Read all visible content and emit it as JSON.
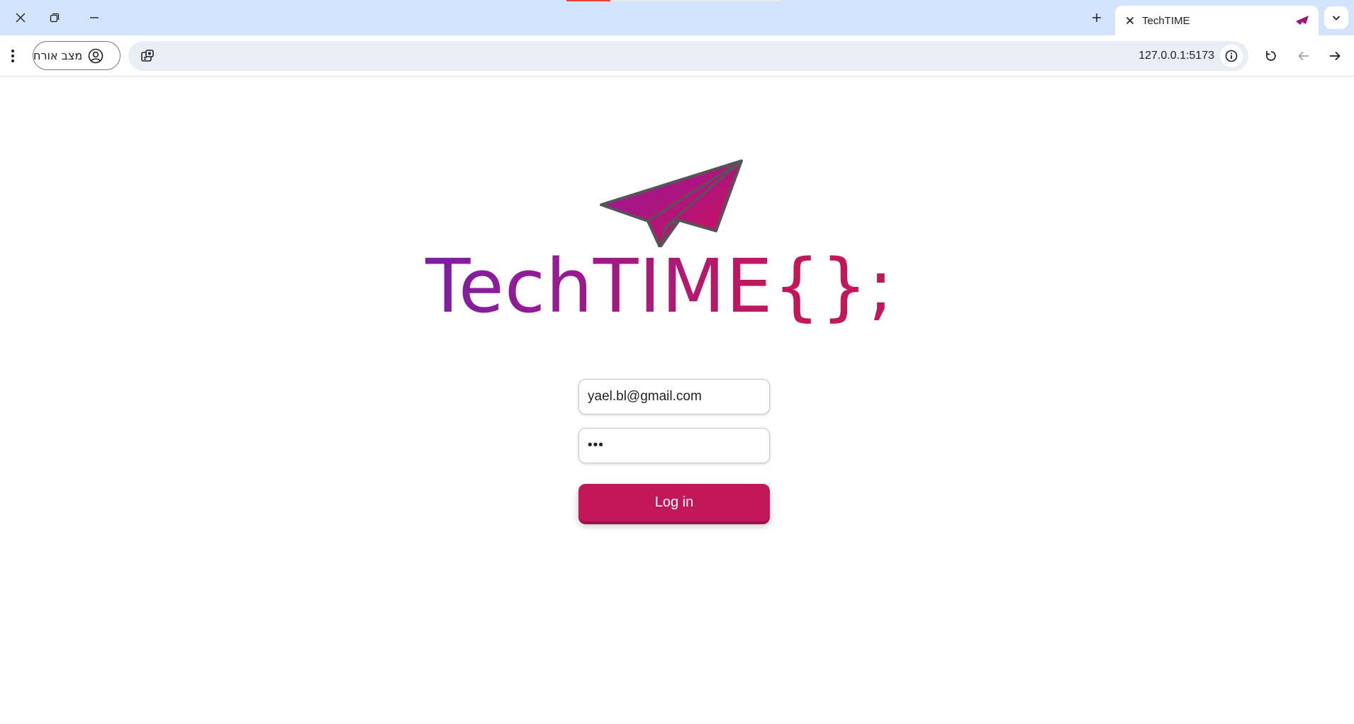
{
  "browser": {
    "tab": {
      "title": "TechTIME"
    },
    "profile_chip": {
      "label": "מצב אורח"
    },
    "omnibox": {
      "url": "127.0.0.1:5173"
    }
  },
  "page": {
    "logo": {
      "word": "TechTIME",
      "braces": "{};"
    },
    "login_form": {
      "email_value": "yael.bl@gmail.com",
      "password_value": "•••",
      "login_label": "Log in"
    }
  },
  "colors": {
    "accent": "#c2185b",
    "logo_purple": "#7b1fa2",
    "tabstrip": "#d3e3fd",
    "omnibox": "#e9eef6"
  },
  "icons": {
    "window_close": "close-icon",
    "window_restore": "restore-icon",
    "window_minimize": "minimize-icon",
    "new_tab": "plus-icon",
    "tab_close": "close-icon",
    "tab_search": "chevron-down-icon",
    "menu": "more-vert-icon",
    "profile": "account-circle-icon",
    "omnibox_left": "camera-translate-icon",
    "site_info": "info-icon",
    "reload": "reload-icon",
    "back": "arrow-left-icon",
    "forward": "arrow-right-icon"
  }
}
